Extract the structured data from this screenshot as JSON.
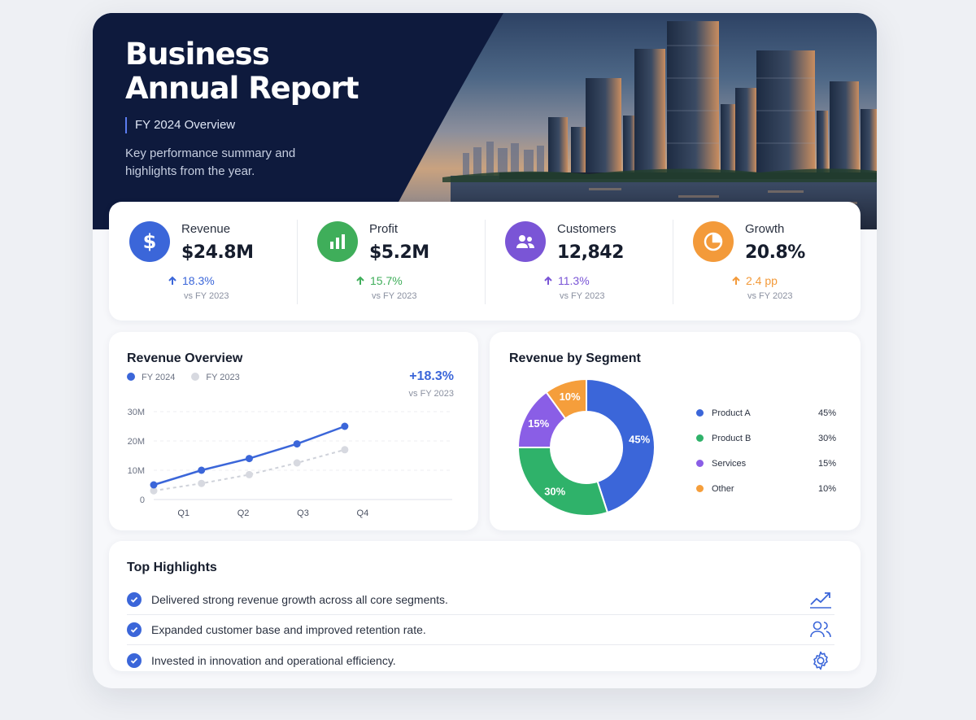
{
  "hero": {
    "title": "Business Annual Report",
    "subtitle": "FY 2024 Overview",
    "description": "Key performance summary and highlights from the year."
  },
  "kpis": [
    {
      "label": "Revenue",
      "value": "$24.8M",
      "change": "18.3%",
      "vs": "vs FY 2023",
      "color": "#3b66d9",
      "icon": "dollar-icon"
    },
    {
      "label": "Profit",
      "value": "$5.2M",
      "change": "15.7%",
      "vs": "vs FY 2023",
      "color": "#3fae5a",
      "icon": "bar-chart-icon"
    },
    {
      "label": "Customers",
      "value": "12,842",
      "change": "11.3%",
      "vs": "vs FY 2023",
      "color": "#7a55d6",
      "icon": "users-icon"
    },
    {
      "label": "Growth",
      "value": "20.8%",
      "change": "2.4 pp",
      "vs": "vs FY 2023",
      "color": "#f39a3a",
      "icon": "pie-chart-icon"
    }
  ],
  "revenue_overview": {
    "title": "Revenue Overview",
    "change": "+18.3%",
    "vs": "vs FY 2023"
  },
  "segments": {
    "title": "Revenue by Segment"
  },
  "chart_data": [
    {
      "type": "line",
      "title": "Revenue Overview",
      "categories": [
        "Q1",
        "Q2",
        "Q3",
        "Q4"
      ],
      "x": [
        0,
        1,
        2,
        3,
        4,
        5
      ],
      "series": [
        {
          "name": "FY 2024",
          "values": [
            5,
            10,
            14,
            19,
            25
          ],
          "color": "#3b66d9"
        },
        {
          "name": "FY 2023",
          "values": [
            3,
            5.5,
            8.5,
            12.5,
            17
          ],
          "color": "#d7d9e0"
        }
      ],
      "yticks": [
        "0",
        "10M",
        "20M",
        "30M"
      ],
      "ylim": [
        0,
        30
      ],
      "grid": true,
      "legend": "top-left"
    },
    {
      "type": "pie",
      "title": "Revenue by Segment",
      "categories": [
        "Product A",
        "Product B",
        "Services",
        "Other"
      ],
      "values": [
        45,
        30,
        15,
        10
      ],
      "labels": [
        "45%",
        "30%",
        "15%",
        "10%"
      ],
      "colors": [
        "#3b66d9",
        "#2fb26a",
        "#8a5ee6",
        "#f59e3b"
      ],
      "legend": "right"
    }
  ],
  "highlights": {
    "title": "Top Highlights",
    "items": [
      {
        "text": "Delivered strong revenue growth across all core segments.",
        "icon": "trend-up-icon"
      },
      {
        "text": "Expanded customer base and improved retention rate.",
        "icon": "users-icon"
      },
      {
        "text": "Invested in innovation and operational efficiency.",
        "icon": "gear-icon"
      }
    ]
  }
}
